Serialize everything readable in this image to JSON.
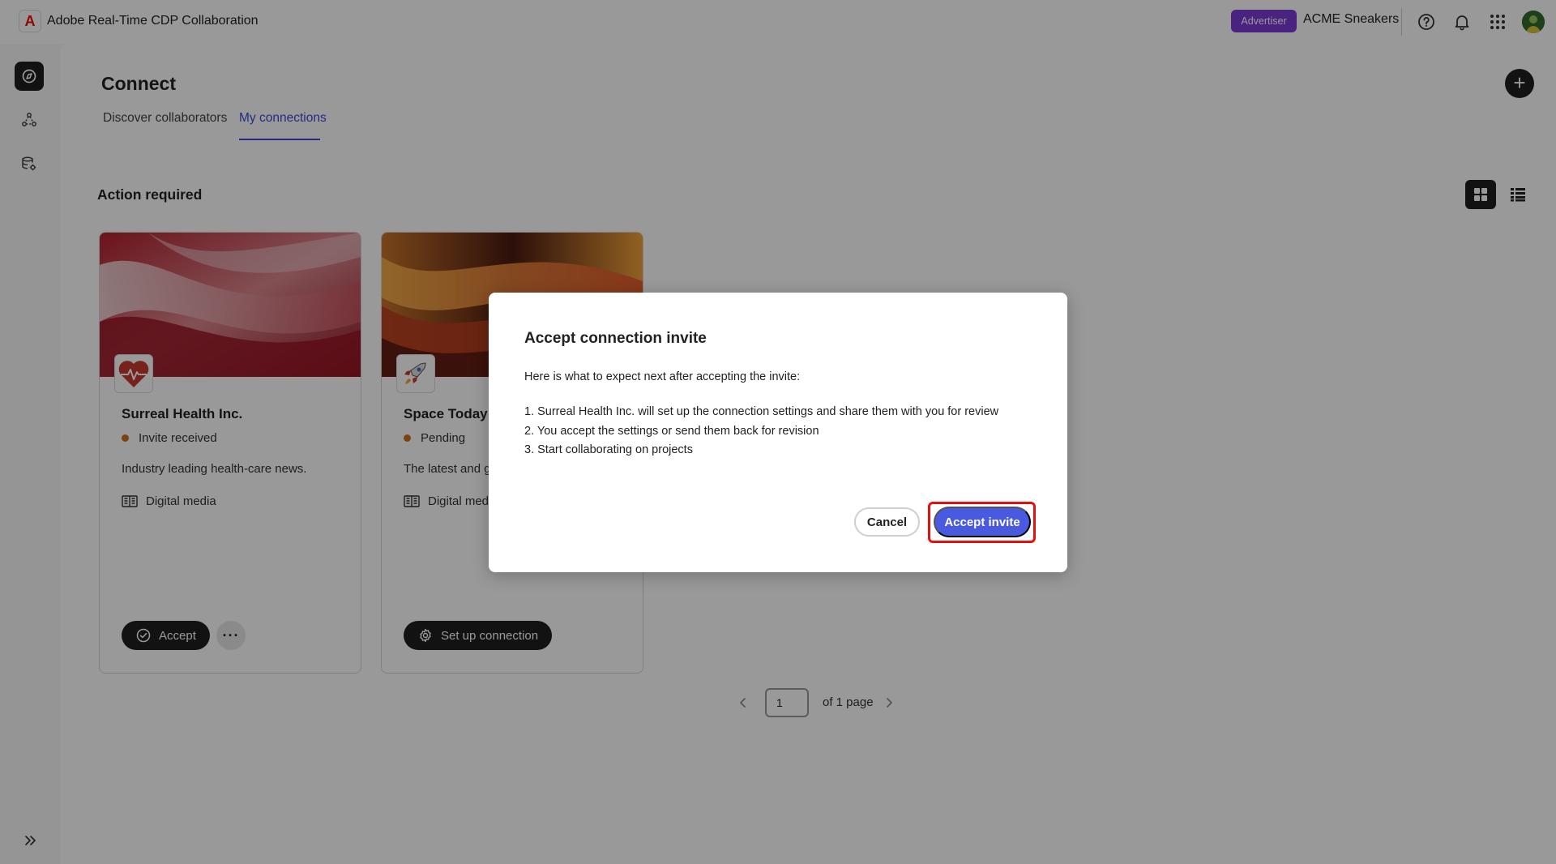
{
  "header": {
    "logo_icon": "adobe-logo-icon",
    "app_title": "Adobe Real-Time CDP Collaboration",
    "role_badge": "Advertiser",
    "org_name": "ACME Sneakers",
    "icons": [
      "help-icon",
      "bell-icon",
      "apps-grid-icon",
      "user-avatar"
    ]
  },
  "sidebar": {
    "items": [
      {
        "icon": "connect-icon",
        "active": true
      },
      {
        "icon": "audiences-icon",
        "active": false
      },
      {
        "icon": "data-settings-icon",
        "active": false
      }
    ],
    "expand_icon": "expand-chevrons-icon"
  },
  "page": {
    "title": "Connect",
    "tabs": [
      {
        "label": "Discover collaborators",
        "active": false
      },
      {
        "label": "My connections",
        "active": true
      }
    ],
    "section_title": "Action required",
    "view_modes": [
      "grid-view-icon",
      "list-view-icon"
    ]
  },
  "cards": [
    {
      "name": "Surreal Health Inc.",
      "status": "Invite received",
      "description": "Industry leading health-care news.",
      "category": "Digital media",
      "action_label": "Accept",
      "logo_icon": "heart-pulse-icon"
    },
    {
      "name": "Space Today",
      "status": "Pending",
      "description": "The latest and gr",
      "category": "Digital medi",
      "action_label": "Set up connection",
      "logo_icon": "rocket-icon"
    }
  ],
  "pagination": {
    "current_page": "1",
    "of_label": "of 1 page"
  },
  "dialog": {
    "title": "Accept connection invite",
    "intro": "Here is what to expect next after accepting the invite:",
    "steps": [
      "1. Surreal Health Inc. will set up the connection settings and share them with you for review",
      "2. You accept the settings or send them back for revision",
      "3. Start collaborating on projects"
    ],
    "cancel_label": "Cancel",
    "accept_label": "Accept invite"
  },
  "colors": {
    "accent": "#3d47d9",
    "primary_button": "#4a5ae0",
    "role_badge": "#7c3bd6",
    "status_dot": "#d0701a",
    "highlight": "#e3110f"
  }
}
